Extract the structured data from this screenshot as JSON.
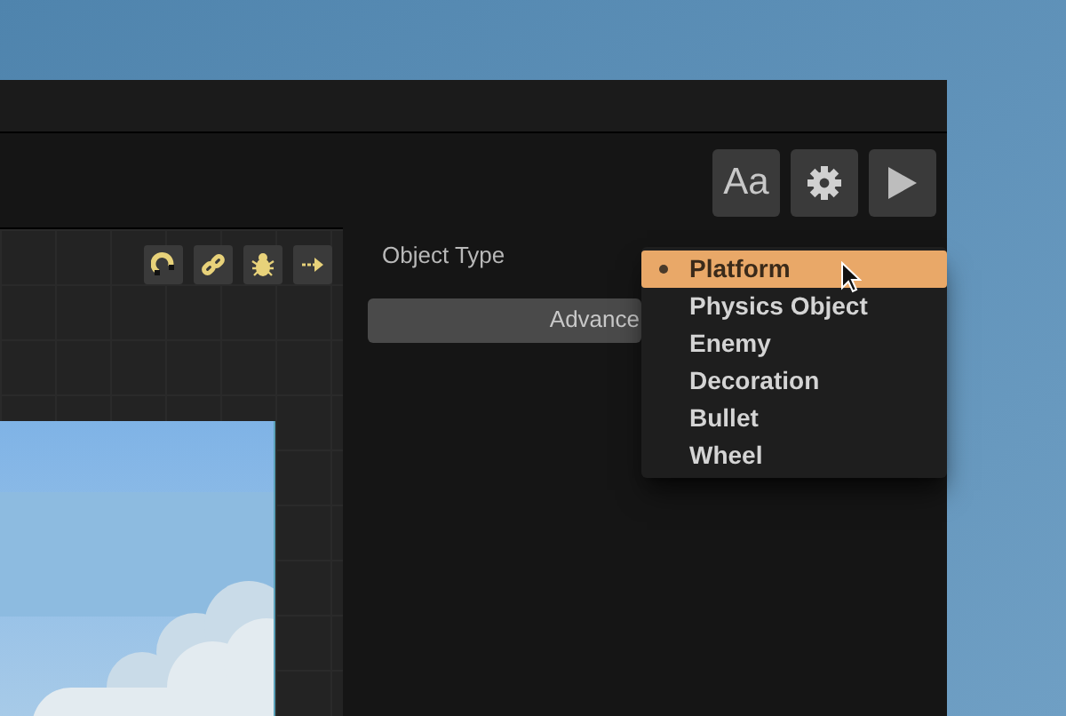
{
  "toolbar": {
    "font_button": "Aa"
  },
  "canvas": {
    "tools": [
      {
        "kind": "magnet"
      },
      {
        "kind": "link"
      },
      {
        "kind": "bug"
      },
      {
        "kind": "arrow"
      }
    ]
  },
  "properties": {
    "label": "Object Type",
    "advanced_button": "Advance"
  },
  "dropdown": {
    "items": [
      {
        "label": "Platform",
        "selected": true
      },
      {
        "label": "Physics Object",
        "selected": false
      },
      {
        "label": "Enemy",
        "selected": false
      },
      {
        "label": "Decoration",
        "selected": false
      },
      {
        "label": "Bullet",
        "selected": false
      },
      {
        "label": "Wheel",
        "selected": false
      }
    ]
  }
}
